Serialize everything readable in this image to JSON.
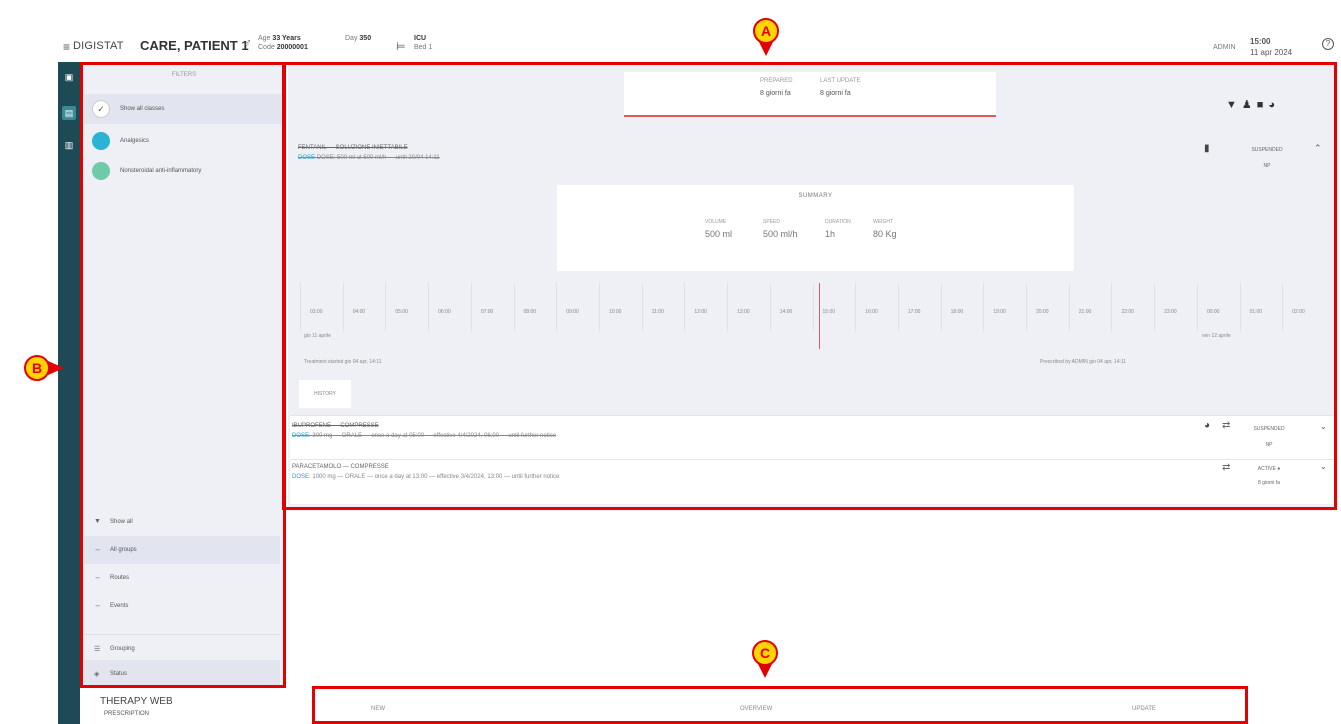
{
  "header": {
    "app_name": "DIGISTAT",
    "patient_name": "CARE, PATIENT 1",
    "gender": "♂",
    "age_label": "Age",
    "age_value": "33 Years",
    "code_label": "Code",
    "code_value": "20000001",
    "day_label": "Day",
    "day_value": "350",
    "ward": "ICU",
    "bed": "Bed 1",
    "user": "ADMIN",
    "time": "15:00",
    "date": "11 apr 2024"
  },
  "filters": {
    "title": "FILTERS",
    "items": [
      {
        "label": "Show all classes"
      },
      {
        "label": "Analgesics",
        "color": "#2bb3d6"
      },
      {
        "label": "Nonsteroidal anti-inflammatory",
        "color": "#6fcaa8"
      }
    ],
    "options": [
      {
        "icon": "funnel-icon",
        "label": "Show all"
      },
      {
        "icon": "arrows-icon",
        "label": "All groups"
      },
      {
        "icon": "arrows-icon",
        "label": "Routes"
      },
      {
        "icon": "arrows-icon",
        "label": "Events"
      },
      {
        "icon": "grouping-icon",
        "label": "Grouping"
      },
      {
        "icon": "status-icon",
        "label": "Status"
      }
    ]
  },
  "info_card": {
    "col1_label": "PREPARED",
    "col1_value": "8 giorni fa",
    "col2_label": "LAST UPDATE",
    "col2_value": "8 giorni fa"
  },
  "therapies": [
    {
      "name": "FENTANIL — SOLUZIONE INIETTABILE",
      "detail": "DOSE: 500 ml at 500 ml/h — until 20/04 14:11",
      "dose_key": "DOSE",
      "status": "SUSPENDED",
      "status_sub": "NP"
    },
    {
      "name": "IBUPROFENE — COMPRESSE",
      "detail": "300 mg — ORALE — once a day at 05:00 — effective 4/4/2024, 06:00 — until further notice",
      "dose_key": "DOSE",
      "status": "SUSPENDED",
      "status_sub": "NP"
    },
    {
      "name": "PARACETAMOLO — COMPRESSE",
      "detail": "1000 mg — ORALE — once a day at 13:00 — effective 3/4/2024, 13:00 — until further notice",
      "dose_key": "DOSE",
      "status": "ACTIVE",
      "status_sub": "8 giorni fa"
    }
  ],
  "summary": {
    "title": "SUMMARY",
    "cols": [
      {
        "label": "VOLUME",
        "value": "500 ml"
      },
      {
        "label": "SPEED",
        "value": "500 ml/h"
      },
      {
        "label": "DURATION",
        "value": "1h"
      },
      {
        "label": "WEIGHT",
        "value": "80 Kg"
      }
    ]
  },
  "timeline": {
    "hours": [
      "03:00",
      "04:00",
      "05:00",
      "06:00",
      "07:00",
      "08:00",
      "09:00",
      "10:00",
      "11:00",
      "12:00",
      "13:00",
      "14:00",
      "15:00",
      "16:00",
      "17:00",
      "18:00",
      "19:00",
      "20:00",
      "21:00",
      "22:00",
      "23:00",
      "00:00",
      "01:00",
      "02:00"
    ],
    "date_left": "gio 11 aprile",
    "date_right": "ven 12 aprile",
    "started": "Treatment started gio 04 apr, 14:11",
    "prescribed": "Prescribed by ADMIN gio 04 apr, 14:11"
  },
  "history_label": "HISTORY",
  "bottom": {
    "app_title": "THERAPY WEB",
    "app_sub": "PRESCRIPTION",
    "new_label": "NEW",
    "overview_label": "OVERVIEW",
    "update_label": "UPDATE"
  },
  "markers": {
    "a": "A",
    "b": "B",
    "c": "C"
  },
  "colors": {
    "annotation": "#e40000",
    "marker_fill": "#ffd500",
    "sidebar": "#1e4a55",
    "panel": "#eef0f6"
  }
}
